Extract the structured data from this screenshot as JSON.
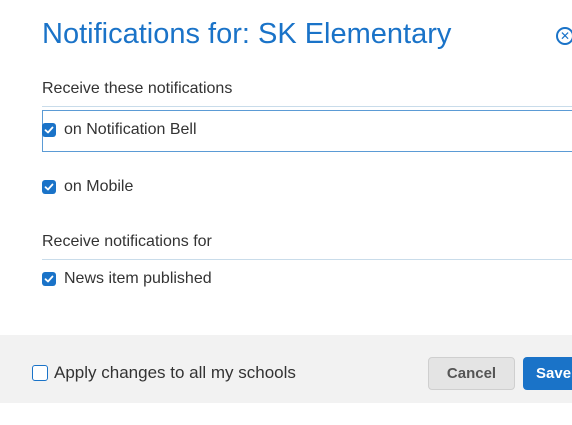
{
  "dialog": {
    "title": "Notifications for: SK Elementary",
    "close_icon": "close-circle-icon"
  },
  "receive_section": {
    "label": "Receive these notifications",
    "options": [
      {
        "label": "on Notification Bell",
        "checked": true
      },
      {
        "label": "on Mobile",
        "checked": true
      }
    ]
  },
  "for_section": {
    "label": "Receive notifications for",
    "options": [
      {
        "label": "News item published",
        "checked": true
      }
    ]
  },
  "footer": {
    "apply_all_label": "Apply changes to all my schools",
    "apply_all_checked": false,
    "cancel_label": "Cancel",
    "save_label": "Save"
  },
  "colors": {
    "accent": "#1a73c8",
    "footer_bg": "#f2f2f2"
  }
}
